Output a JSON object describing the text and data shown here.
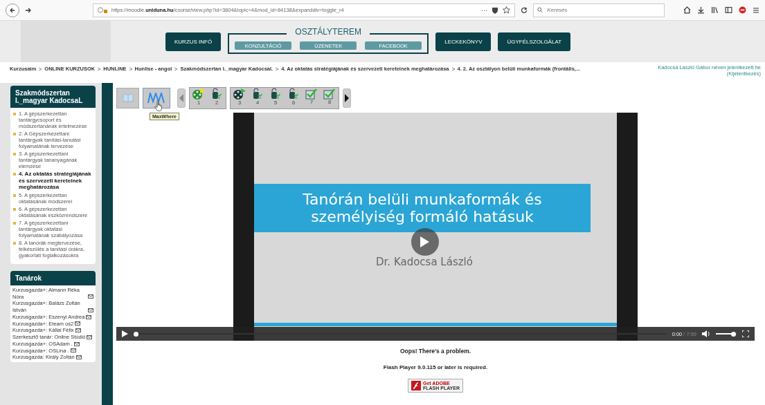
{
  "browser": {
    "url": "https://moodle.**uniduna.hu**/course/view.php?id=3804&topic=4&mod_id=84138&expanddiv=toggle_r4",
    "more": "···",
    "search_placeholder": "Keresés"
  },
  "nav": {
    "left_buttons": [
      "KURZUS INFÓ"
    ],
    "group_title": "OSZTÁLYTEREM",
    "group_buttons": [
      "KONZULTÁCIÓ",
      "ÜZENETEK",
      "FACEBOOK"
    ],
    "right_buttons": [
      "LECKEKÖNYV",
      "ÜGYFÉLSZOLGÁLAT"
    ]
  },
  "breadcrumb": [
    "Kurzusaim",
    "ONLINE KURZUSOK",
    "HUNLINE",
    "Hunlise - angol",
    "Szakmódszertan I._magyar Kadocsal.",
    "4. Az oktatás stratégiájának és szervezeti kereteinek meghatározása",
    "4. 2. Az osztályon belüli munkaformák (frontális,..."
  ],
  "login_text": "Kadocsa László Gábor néven jelentkezett be (Kijelentkezés)",
  "course_block": {
    "title": "Szakmódszertan I._magyar KadocsaL",
    "items": [
      {
        "label": "1. A gépszerkezettan tantárgycsoport és módszertanának értelmezése",
        "selected": false
      },
      {
        "label": "2. A Gépszerkezettani tantárgyak tanítási-tanulási folyamatának tervezése",
        "selected": false
      },
      {
        "label": "3.  A gépszerkezettani tantárgyak tananyagának elemzése",
        "selected": false
      },
      {
        "label": "4. Az oktatás stratégiájának és szervezeti kereteinek meghatározása",
        "selected": true
      },
      {
        "label": "5. A gépszerkezettan oktatásának módszerei",
        "selected": false
      },
      {
        "label": "6. A gépszerkezettan oktatásának eszközrendszere",
        "selected": false
      },
      {
        "label": "7. A gépszerkezettani tantárgyak oktatási folyamatának szabályozása",
        "selected": false
      },
      {
        "label": "8. A tanórák megtervezése, felkészülés a tanítási órákra, gyakorlati foglalkozásokra",
        "selected": false
      }
    ]
  },
  "teachers_block": {
    "title": "Tanárok",
    "items": [
      "Kurzusgazda+: Almann Réka Nóra",
      "Kurzusgazda+: Balázs Zoltán István",
      "Kurzusgazda+: Eszenyi Andrea",
      "Kurzusgazda+: Eteam os2",
      "Kurzusgazda+: Kállai Félix",
      "Szerkesztő tanár: Online Stúdió",
      "Kurzusgazda+: OSAdam .",
      "Kurzusgazda+: OSLina .",
      "Kurzusgazda: Király Zoltán"
    ]
  },
  "toolbar": {
    "tooltip": "MaxWhere",
    "groups": [
      [
        {
          "number": "1",
          "kind": "current_video"
        },
        {
          "number": "2",
          "kind": "task"
        }
      ],
      [
        {
          "number": "3",
          "kind": "video"
        },
        {
          "number": "4",
          "kind": "task"
        },
        {
          "number": "5",
          "kind": "task"
        },
        {
          "number": "6",
          "kind": "task"
        },
        {
          "number": "7",
          "kind": "check"
        },
        {
          "number": "8",
          "kind": "check"
        }
      ]
    ]
  },
  "video": {
    "slide_title": [
      "Tanórán belüli munkaformák és",
      "személyiség formáló hatásuk"
    ],
    "author": "Dr. Kadocsa László",
    "level": 0,
    "time": "0:00",
    "duration": "/ 7:59",
    "volume": {
      "level": 0.85
    }
  },
  "flash": {
    "error": "Oops! There's a problem.",
    "requirement": "Flash Player 9.0.115 or later is required.",
    "badge_small": "Get ADOBE",
    "badge_big": "FLASH PLAYER"
  }
}
